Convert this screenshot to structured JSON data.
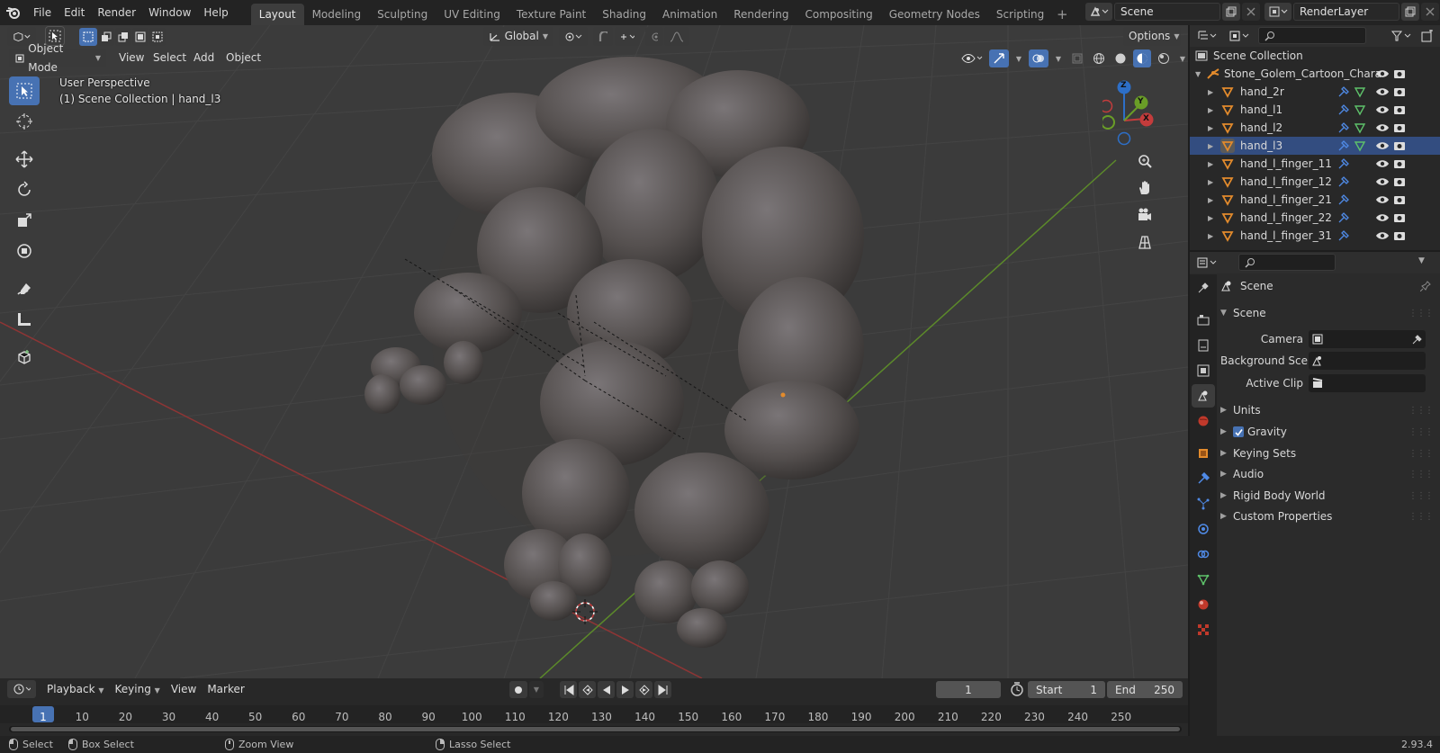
{
  "topbar": {
    "menus": [
      "File",
      "Edit",
      "Render",
      "Window",
      "Help"
    ],
    "workspaces": [
      "Layout",
      "Modeling",
      "Sculpting",
      "UV Editing",
      "Texture Paint",
      "Shading",
      "Animation",
      "Rendering",
      "Compositing",
      "Geometry Nodes",
      "Scripting"
    ],
    "active_workspace": "Layout",
    "scene_name": "Scene",
    "view_layer_name": "RenderLayer"
  },
  "viewport": {
    "transform_orientation": "Global",
    "options_label": "Options",
    "mode": "Object Mode",
    "menus": [
      "View",
      "Select",
      "Add",
      "Object"
    ],
    "overlay_line1": "User Perspective",
    "overlay_line2": "(1) Scene Collection | hand_l3",
    "gizmo_axes": {
      "x": "X",
      "y": "Y",
      "z": "Z"
    }
  },
  "timeline": {
    "menus": [
      "Playback",
      "Keying",
      "View",
      "Marker"
    ],
    "current_frame": "1",
    "start_label": "Start",
    "start_value": "1",
    "end_label": "End",
    "end_value": "250",
    "ticks": [
      "1",
      "10",
      "20",
      "30",
      "40",
      "50",
      "60",
      "70",
      "80",
      "90",
      "100",
      "110",
      "120",
      "130",
      "140",
      "150",
      "160",
      "170",
      "180",
      "190",
      "200",
      "210",
      "220",
      "230",
      "240",
      "250"
    ]
  },
  "statusbar": {
    "select": "Select",
    "box_select": "Box Select",
    "zoom_view": "Zoom View",
    "lasso_select": "Lasso Select",
    "version": "2.93.4"
  },
  "outliner": {
    "root": "Scene Collection",
    "armature": "Stone_Golem_Cartoon_Chara",
    "items": [
      {
        "name": "hand_2r",
        "mesh": true
      },
      {
        "name": "hand_l1",
        "mesh": true
      },
      {
        "name": "hand_l2",
        "mesh": true
      },
      {
        "name": "hand_l3",
        "mesh": true,
        "selected": true
      },
      {
        "name": "hand_l_finger_11",
        "mesh": false
      },
      {
        "name": "hand_l_finger_12",
        "mesh": false
      },
      {
        "name": "hand_l_finger_21",
        "mesh": false
      },
      {
        "name": "hand_l_finger_22",
        "mesh": false
      },
      {
        "name": "hand_l_finger_31",
        "mesh": false
      }
    ]
  },
  "properties": {
    "context_title": "Scene",
    "panel_title": "Scene",
    "camera_label": "Camera",
    "background_label": "Background Sce...",
    "active_clip_label": "Active Clip",
    "subpanels": [
      "Units",
      "Gravity",
      "Keying Sets",
      "Audio",
      "Rigid Body World",
      "Custom Properties"
    ],
    "gravity_checked": true
  },
  "colors": {
    "accent": "#4772b3",
    "x_axis": "#c43c3c",
    "y_axis": "#6a9e27",
    "z_axis": "#2d6fc8",
    "orange": "#e38b2c"
  }
}
